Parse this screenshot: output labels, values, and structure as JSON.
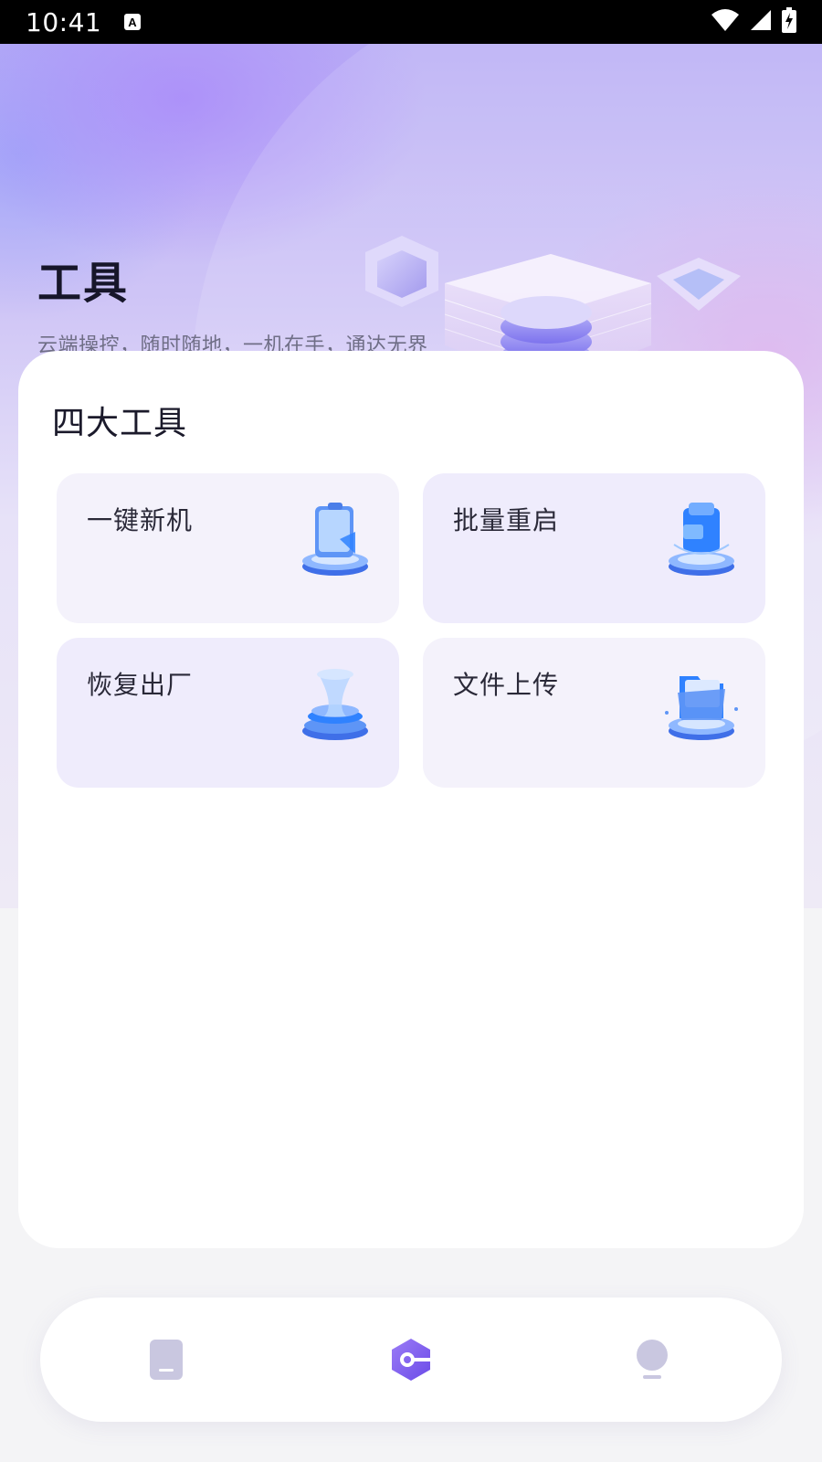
{
  "status_bar": {
    "time": "10:41",
    "icons": [
      "keyboard-a-icon",
      "wifi-icon",
      "signal-icon",
      "battery-charging-icon"
    ]
  },
  "hero": {
    "title": "工具",
    "subtitle": "云端操控，随时随地，一机在手，通达无界"
  },
  "tools_section": {
    "title": "四大工具",
    "tools": [
      {
        "label": "一键新机",
        "icon": "new-phone-icon"
      },
      {
        "label": "批量重启",
        "icon": "batch-restart-icon"
      },
      {
        "label": "恢复出厂",
        "icon": "factory-reset-icon"
      },
      {
        "label": "文件上传",
        "icon": "file-upload-icon"
      }
    ]
  },
  "bottom_nav": {
    "items": [
      {
        "icon": "phone-tab-icon",
        "active": false
      },
      {
        "icon": "tools-tab-icon",
        "active": true
      },
      {
        "icon": "profile-tab-icon",
        "active": false
      }
    ]
  },
  "colors": {
    "accent": "#7a5cf0",
    "inactive_icon": "#c9c7e0",
    "tile_bg": "#f4f2fb",
    "tile_bg_alt": "#efecfc"
  }
}
